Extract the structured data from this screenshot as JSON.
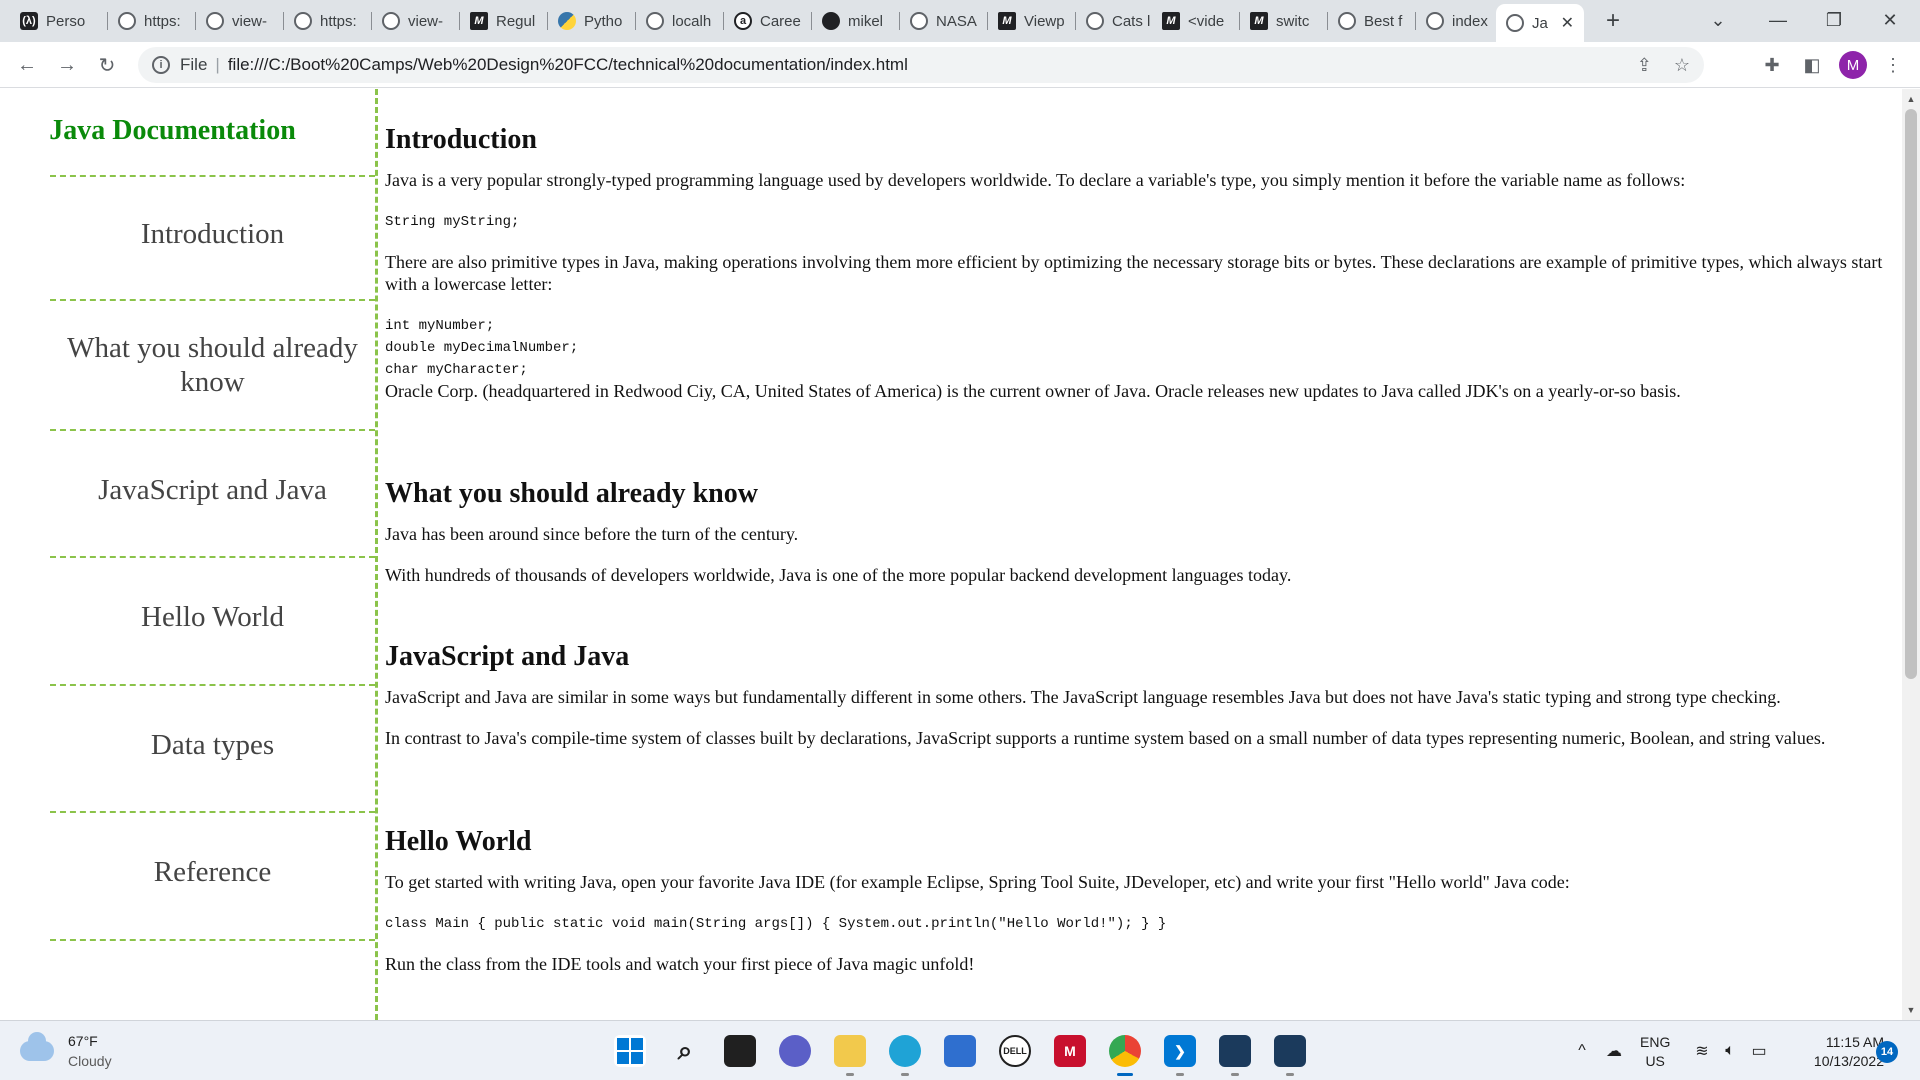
{
  "browser": {
    "tabs": [
      {
        "label": "Perso",
        "icon": "fcc-icon"
      },
      {
        "label": "https:",
        "icon": "globe-icon"
      },
      {
        "label": "view-",
        "icon": "globe-icon"
      },
      {
        "label": "https:",
        "icon": "globe-icon"
      },
      {
        "label": "view-",
        "icon": "globe-icon"
      },
      {
        "label": "Regul",
        "icon": "m-icon"
      },
      {
        "label": "Pytho",
        "icon": "python-icon"
      },
      {
        "label": "localh",
        "icon": "globe-icon"
      },
      {
        "label": "Caree",
        "icon": "circle-a-icon"
      },
      {
        "label": "mikel",
        "icon": "github-icon"
      },
      {
        "label": "NASA",
        "icon": "globe-icon"
      },
      {
        "label": "Viewp",
        "icon": "m-icon"
      },
      {
        "label": "Cats l",
        "icon": "globe-icon"
      },
      {
        "label": "<vide",
        "icon": "m-icon"
      },
      {
        "label": "switc",
        "icon": "m-icon"
      },
      {
        "label": "Best f",
        "icon": "globe-icon"
      },
      {
        "label": "index",
        "icon": "globe-icon"
      },
      {
        "label": "Ja",
        "icon": "globe-icon",
        "active": true
      }
    ],
    "new_tab": "+",
    "address": {
      "scheme_label": "File",
      "url": "file:///C:/Boot%20Camps/Web%20Design%20FCC/technical%20documentation/index.html"
    },
    "avatar_letter": "M"
  },
  "page": {
    "nav_title": "Java Documentation",
    "nav_links": [
      "Introduction",
      "What you should already know",
      "JavaScript and Java",
      "Hello World",
      "Data types",
      "Reference"
    ],
    "sections": {
      "introduction": {
        "title": "Introduction",
        "p1": "Java is a very popular strongly-typed programming language used by developers worldwide. To declare a variable's type, you simply mention it before the variable name as follows:",
        "code1": "String myString;",
        "p2": "There are also primitive types in Java, making operations involving them more efficient by optimizing the necessary storage bits or bytes. These declarations are example of primitive types, which always start with a lowercase letter:",
        "code2": "int myNumber;\ndouble myDecimalNumber;\nchar myCharacter;",
        "p3": "Oracle Corp. (headquartered in Redwood Ciy, CA, United States of America) is the current owner of Java. Oracle releases new updates to Java called JDK's on a yearly-or-so basis."
      },
      "know": {
        "title": "What you should already know",
        "p1": "Java has been around since before the turn of the century.",
        "p2": "With hundreds of thousands of developers worldwide, Java is one of the more popular backend development languages today."
      },
      "jsjava": {
        "title": "JavaScript and Java",
        "p1": "JavaScript and Java are similar in some ways but fundamentally different in some others. The JavaScript language resembles Java but does not have Java's static typing and strong type checking.",
        "p2": "In contrast to Java's compile-time system of classes built by declarations, JavaScript supports a runtime system based on a small number of data types representing numeric, Boolean, and string values."
      },
      "hello": {
        "title": "Hello World",
        "p1": "To get started with writing Java, open your favorite Java IDE (for example Eclipse, Spring Tool Suite, JDeveloper, etc) and write your first \"Hello world\" Java code:",
        "code1": "class Main { public static void main(String args[]) { System.out.println(\"Hello World!\"); } }",
        "p2": "Run the class from the IDE tools and watch your first piece of Java magic unfold!"
      }
    }
  },
  "taskbar": {
    "weather_temp": "67°F",
    "weather_desc": "Cloudy",
    "lang_top": "ENG",
    "lang_bottom": "US",
    "time": "11:15 AM",
    "date": "10/13/2022",
    "notifications": "14"
  },
  "colors": {
    "nav_title": "#0a8a0a",
    "nav_border": "#8bc34a"
  }
}
